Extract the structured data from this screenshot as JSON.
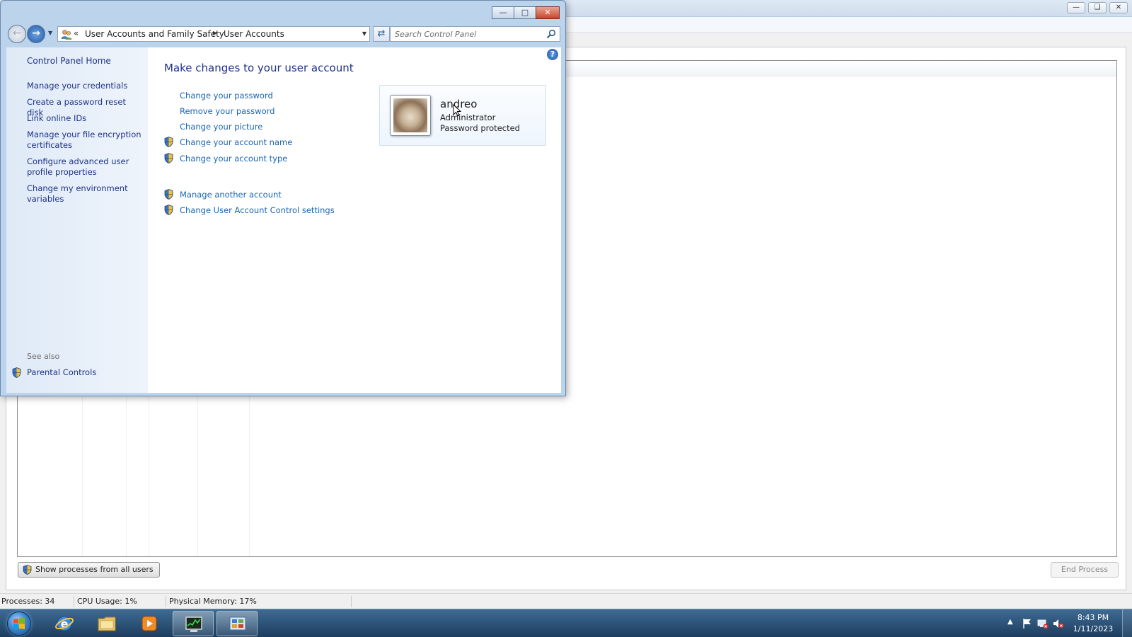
{
  "control_panel": {
    "breadcrumb": {
      "overflow": "«",
      "parent": "User Accounts and Family Safety",
      "current": "User Accounts"
    },
    "search": {
      "placeholder": "Search Control Panel"
    },
    "sidebar": {
      "home": "Control Panel Home",
      "links": [
        "Manage your credentials",
        "Create a password reset disk",
        "Link online IDs",
        "Manage your file encryption certificates",
        "Configure advanced user profile properties",
        "Change my environment variables"
      ],
      "see_also": "See also",
      "parental_controls": "Parental Controls"
    },
    "main": {
      "heading": "Make changes to your user account",
      "tasks": [
        "Change your password",
        "Remove your password",
        "Change your picture",
        "Change your account name",
        "Change your account type"
      ],
      "other_tasks": [
        "Manage another account",
        "Change User Account Control settings"
      ]
    },
    "account": {
      "name": "andreo",
      "role": "Administrator",
      "status": "Password protected"
    }
  },
  "task_manager": {
    "show_processes_label": "Show processes from all users",
    "end_process_label": "End Process",
    "status": {
      "processes": "Processes: 34",
      "cpu": "CPU Usage: 1%",
      "memory": "Physical Memory: 17%"
    }
  },
  "taskbar": {
    "time": "8:43 PM",
    "date": "1/11/2023"
  },
  "colors": {
    "link": "#1b65b0",
    "heading": "#1e3287",
    "taskbar": "#2a5075",
    "close_button": "#c9452a"
  }
}
